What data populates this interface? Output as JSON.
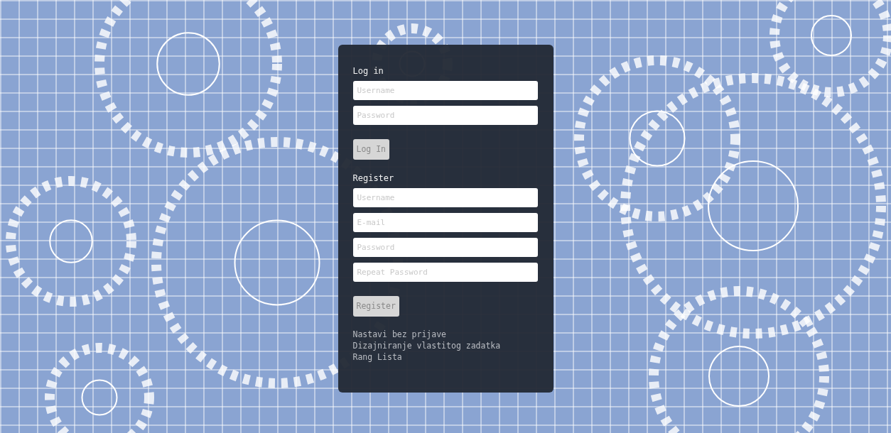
{
  "login": {
    "heading": "Log in",
    "fields": [
      {
        "placeholder": "Username"
      },
      {
        "placeholder": "Password"
      }
    ],
    "button": "Log In"
  },
  "register": {
    "heading": "Register",
    "fields": [
      {
        "placeholder": "Username"
      },
      {
        "placeholder": "E-mail"
      },
      {
        "placeholder": "Password"
      },
      {
        "placeholder": "Repeat Password"
      }
    ],
    "button": "Register"
  },
  "links": [
    "Nastavi bez prijave",
    "Dizajniranje vlastitog zadatka",
    "Rang Lista"
  ]
}
